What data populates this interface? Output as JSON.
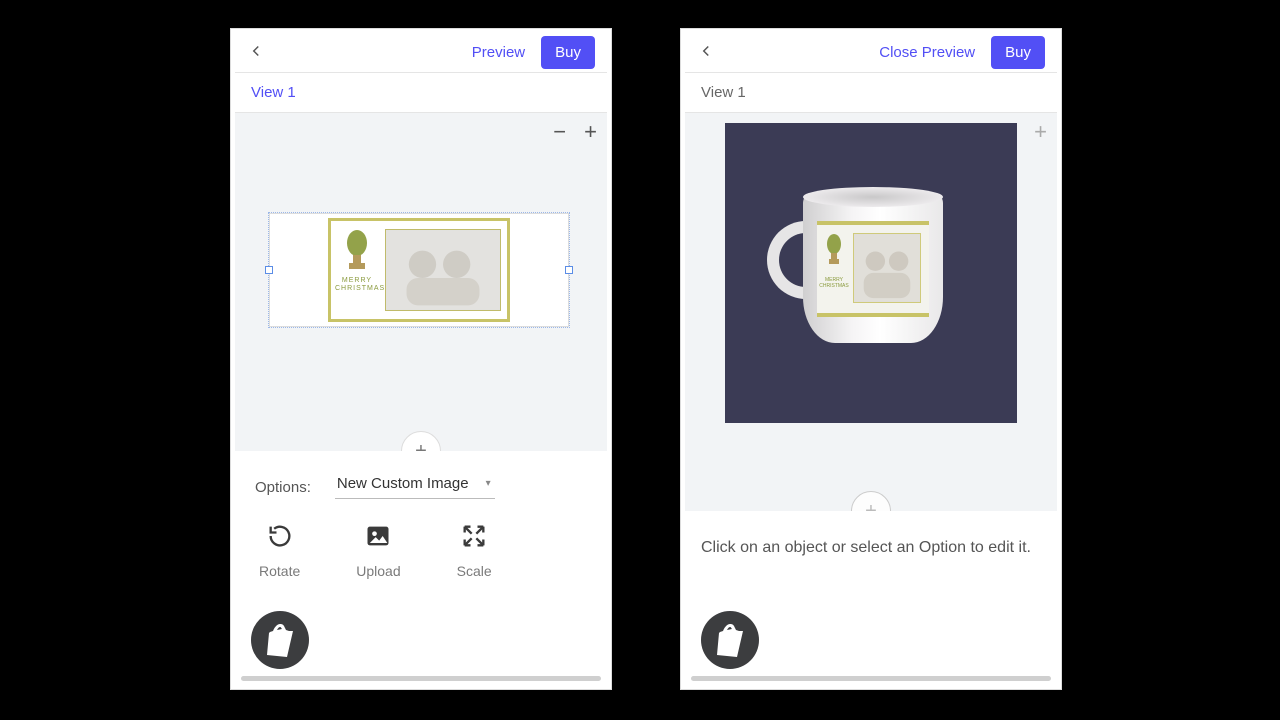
{
  "left": {
    "topbar": {
      "preview": "Preview",
      "buy": "Buy"
    },
    "view_tab": "View 1",
    "zoom": {
      "minus": "−",
      "plus": "+"
    },
    "card_text": "MERRY CHRISTMAS",
    "add_fab": "+",
    "options_label": "Options:",
    "options_value": "New Custom Image",
    "tools": {
      "rotate": "Rotate",
      "upload": "Upload",
      "scale": "Scale"
    }
  },
  "right": {
    "topbar": {
      "close": "Close Preview",
      "buy": "Buy"
    },
    "view_tab": "View 1",
    "zoom": {
      "minus": "−",
      "plus": "+"
    },
    "add_fab": "+",
    "hint": "Click on an object or select an Option to edit it."
  }
}
